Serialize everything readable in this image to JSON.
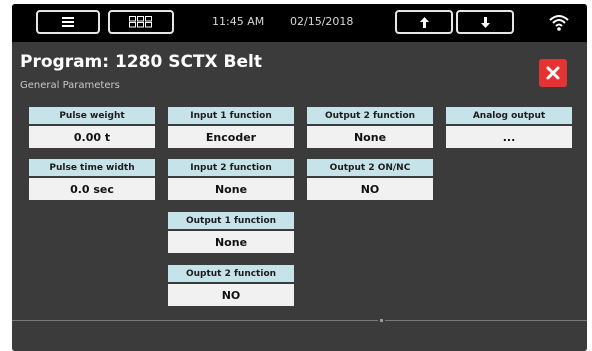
{
  "status_bar": {
    "time": "11:45 AM",
    "date": "02/15/2018",
    "icons": [
      "menu-icon",
      "grid-icon",
      "arrow-up-icon",
      "arrow-down-icon",
      "wifi-icon"
    ]
  },
  "header": {
    "title": "Program: 1280 SCTX Belt",
    "subtitle": "General Parameters",
    "close_icon": "close-icon",
    "close_color": "#e33333"
  },
  "colors": {
    "background": "#3b3b3b",
    "topbar": "#000000",
    "label_bg": "#c7e3ea",
    "value_bg": "#f1f1f1"
  },
  "params": {
    "pulse_weight": {
      "label": "Pulse weight",
      "value": "0.00 t"
    },
    "pulse_time_width": {
      "label": "Pulse time width",
      "value": "0.0 sec"
    },
    "input1_function": {
      "label": "Input 1 function",
      "value": "Encoder"
    },
    "input2_function": {
      "label": "Input 2 function",
      "value": "None"
    },
    "output1_function": {
      "label": "Output 1 function",
      "value": "None"
    },
    "ouptut2_function": {
      "label": "Ouptut 2 function",
      "value": "NO"
    },
    "output2_function": {
      "label": "Output 2 function",
      "value": "None"
    },
    "output2_on_nc": {
      "label": "Output 2 ON/NC",
      "value": "NO"
    },
    "analog_output": {
      "label": "Analog output",
      "value": "..."
    }
  }
}
